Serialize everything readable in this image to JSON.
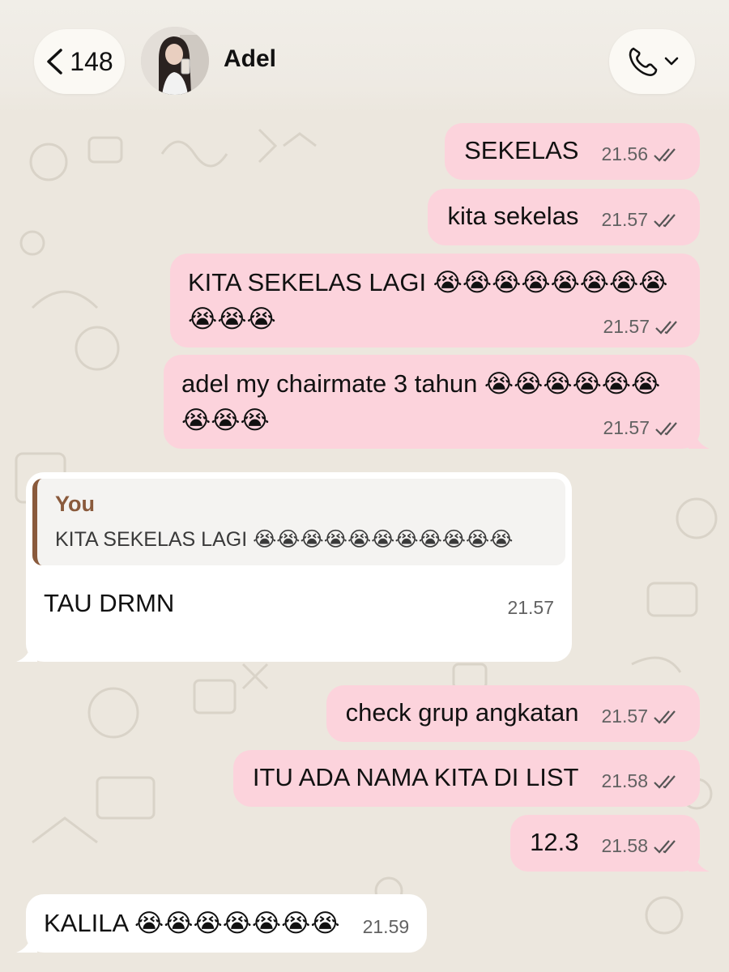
{
  "header": {
    "back_count": "148",
    "contact_name": "Adel",
    "back_icon": "chevron-left-icon",
    "call_icon": "phone-icon",
    "dropdown_icon": "chevron-down-icon"
  },
  "colors": {
    "outgoing_bubble": "#fcd3dc",
    "incoming_bubble": "#ffffff",
    "quote_accent": "#8a5a3c",
    "background": "#ece7de"
  },
  "messages": [
    {
      "direction": "out",
      "text": "SEKELAS",
      "time": "21.56",
      "status": "read"
    },
    {
      "direction": "out",
      "text": "kita sekelas",
      "time": "21.57",
      "status": "read"
    },
    {
      "direction": "out",
      "text": "KITA SEKELAS LAGI 😭😭😭😭😭😭😭😭😭😭😭",
      "time": "21.57",
      "status": "read"
    },
    {
      "direction": "out",
      "text": "adel my chairmate 3 tahun 😭😭😭😭😭😭😭😭😭",
      "time": "21.57",
      "status": "read"
    },
    {
      "direction": "in",
      "quote_author": "You",
      "quote_text": "KITA SEKELAS LAGI 😭😭😭😭😭😭😭😭😭😭😭",
      "text": "TAU DRMN",
      "time": "21.57"
    },
    {
      "direction": "out",
      "text": "check grup angkatan",
      "time": "21.57",
      "status": "read"
    },
    {
      "direction": "out",
      "text": "ITU ADA NAMA KITA DI LIST",
      "time": "21.58",
      "status": "read"
    },
    {
      "direction": "out",
      "text": "12.3",
      "time": "21.58",
      "status": "read"
    },
    {
      "direction": "in",
      "text": "KALILA 😭😭😭😭😭😭😭",
      "time": "21.59"
    }
  ]
}
